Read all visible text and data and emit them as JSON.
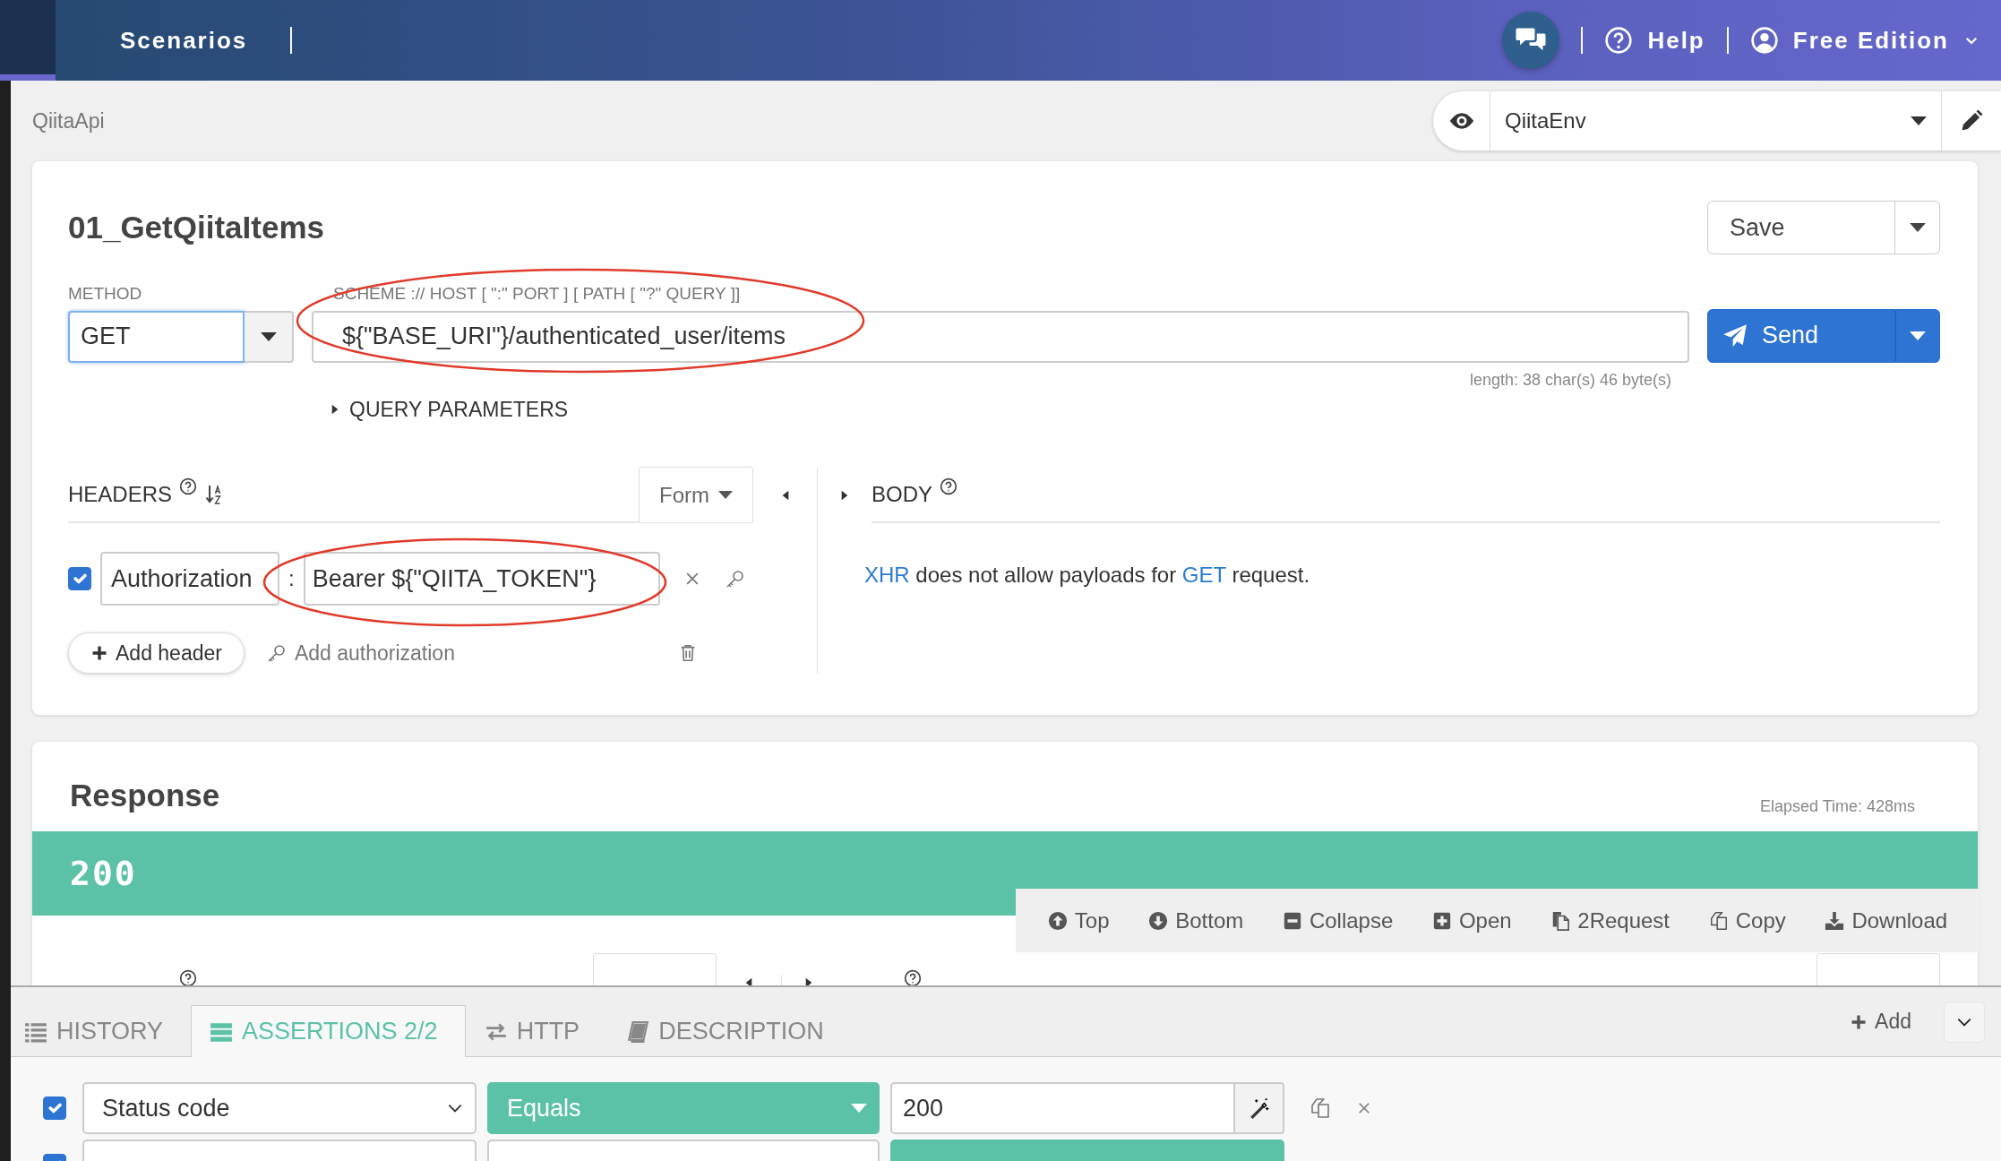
{
  "navbar": {
    "title": "Scenarios",
    "help": "Help",
    "edition": "Free Edition"
  },
  "breadcrumb": "QiitaApi",
  "environment": {
    "value": "QiitaEnv"
  },
  "request": {
    "name": "01_GetQiitaItems",
    "save": "Save",
    "method_label": "METHOD",
    "method": "GET",
    "url_label": "SCHEME :// HOST [ \":\" PORT ] [ PATH [ \"?\" QUERY ]]",
    "url": "${\"BASE_URI\"}/authenticated_user/items",
    "send": "Send",
    "length": "length: 38 char(s) 46 byte(s)",
    "query_parameters": {
      "label": "QUERY PARAMETERS",
      "expanded": false
    },
    "headers": {
      "label": "HEADERS",
      "mode": "Form",
      "items": [
        {
          "checked": true,
          "name": "Authorization",
          "separator": ":",
          "value": "Bearer ${\"QIITA_TOKEN\"}"
        }
      ],
      "add_header": "Add header",
      "add_authorization": "Add authorization"
    },
    "body": {
      "label": "BODY",
      "message": [
        {
          "kind": "link",
          "text": "XHR"
        },
        {
          "kind": "text",
          "text": " does not allow payloads for "
        },
        {
          "kind": "link",
          "text": "GET"
        },
        {
          "kind": "text",
          "text": " request."
        }
      ]
    }
  },
  "response": {
    "title": "Response",
    "elapsed": "Elapsed Time: 428ms",
    "status": "200",
    "toolbar": [
      {
        "kind": "top",
        "label": "Top"
      },
      {
        "kind": "bottom",
        "label": "Bottom"
      },
      {
        "kind": "collapse",
        "label": "Collapse"
      },
      {
        "kind": "open",
        "label": "Open"
      },
      {
        "kind": "to_request",
        "label": "2Request"
      },
      {
        "kind": "copy",
        "label": "Copy"
      },
      {
        "kind": "download",
        "label": "Download"
      }
    ]
  },
  "panel": {
    "tabs": [
      {
        "kind": "history",
        "label": "HISTORY",
        "selected": false
      },
      {
        "kind": "assertions",
        "label": "ASSERTIONS 2/2",
        "selected": true
      },
      {
        "kind": "http",
        "label": "HTTP",
        "selected": false
      },
      {
        "kind": "description",
        "label": "DESCRIPTION",
        "selected": false
      }
    ],
    "add": "Add",
    "assertions": [
      {
        "checked": true,
        "target": "Status code",
        "operator": "Equals",
        "value": "200"
      },
      {
        "checked": true
      }
    ]
  }
}
